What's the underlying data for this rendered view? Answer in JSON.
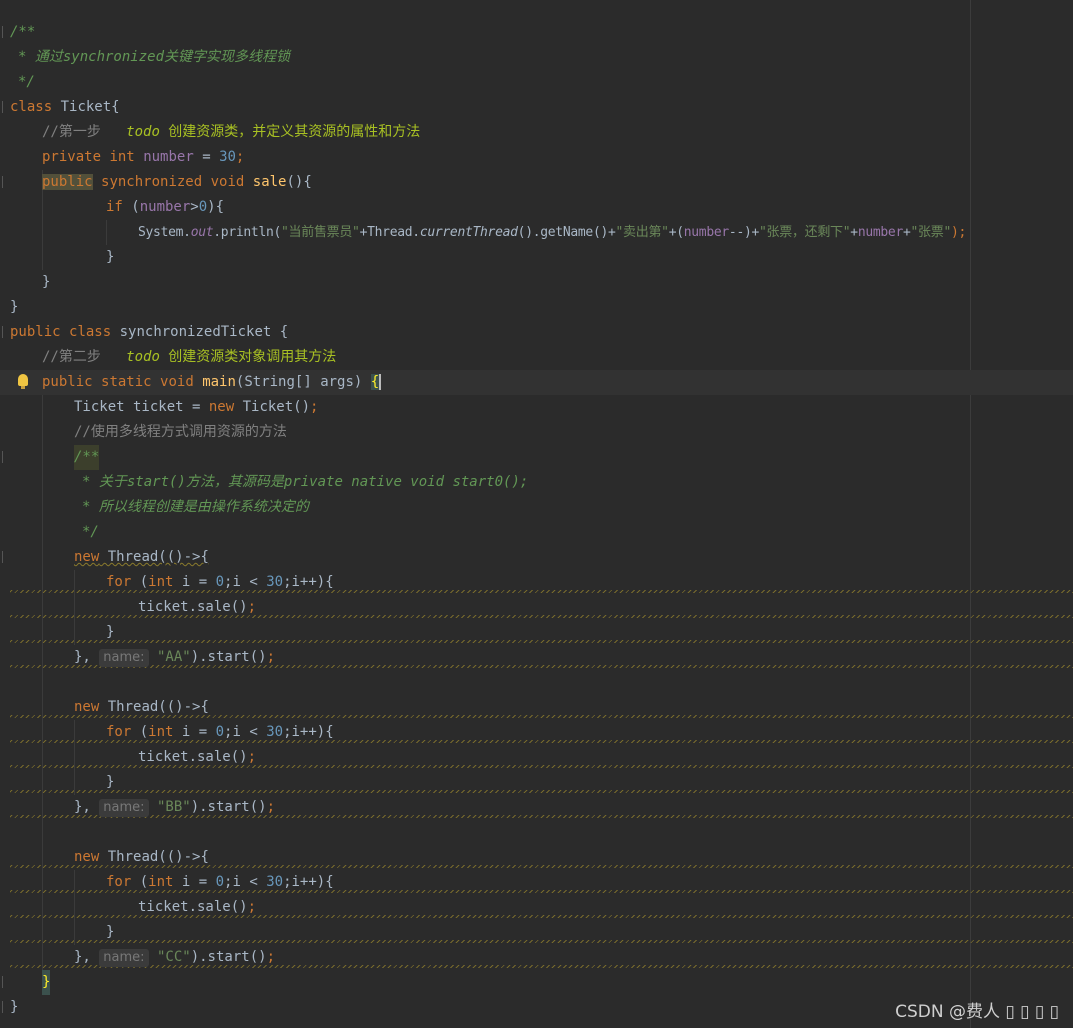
{
  "editor": {
    "l1": {
      "t": "/**"
    },
    "l2": {
      "star": "* ",
      "t1": "通过",
      "t2": "synchronized",
      "t3": "关键字实现多线程锁"
    },
    "l3": {
      "t": "*/"
    },
    "l4": {
      "kw": "class",
      "t": " Ticket{"
    },
    "l5": {
      "cmt": "//第一步   ",
      "todo": "todo",
      "todotxt": " 创建资源类，并定义其资源的属性和方法"
    },
    "l6": {
      "kw1": "private",
      "kw2": "int",
      "fld": "number",
      "eq": " = ",
      "num": "30",
      "semi": ";"
    },
    "l7": {
      "kw1": "public",
      "kw2": "synchronized",
      "kw3": "void",
      "fn": "sale",
      "rest": "(){"
    },
    "l8": {
      "kw": "if",
      "p1": " (",
      "fld": "number",
      "op": ">",
      "num": "0",
      "p2": "){"
    },
    "l9": {
      "a": "System.",
      "b": "out",
      "c": ".println(",
      "s1": "\"当前售票员\"",
      "d": "+Thread.",
      "e": "currentThread",
      "f": "().getName()+",
      "s2": "\"卖出第\"",
      "g": "+(",
      "fld1": "number",
      "h": "--)+",
      "s3": "\"张票，还剩下\"",
      "i": "+",
      "fld2": "number",
      "j": "+",
      "s4": "\"张票\"",
      "k": ");"
    },
    "l10": {
      "t": "}"
    },
    "l11": {
      "t": "}"
    },
    "l12": {
      "t": "}"
    },
    "l13": {
      "kw1": "public",
      "kw2": "class",
      "t": " synchronizedTicket {"
    },
    "l14": {
      "cmt": "//第二步   ",
      "todo": "todo",
      "todotxt": " 创建资源类对象调用其方法"
    },
    "l15": {
      "kw1": "public",
      "kw2": "static",
      "kw3": "void",
      "fn": "main",
      "rest": "(String[] args) ",
      "brace": "{"
    },
    "l16": {
      "a": "Ticket ticket = ",
      "kw": "new",
      "b": " Ticket()",
      "semi": ";"
    },
    "l17": {
      "t": "//使用多线程方式调用资源的方法"
    },
    "l18": {
      "t": "/**"
    },
    "l19": {
      "star": "* ",
      "t1": "关于",
      "t2": "start()",
      "t3": "方法，其源码是",
      "t4": "private native void start0();"
    },
    "l20": {
      "t": "* 所以线程创建是由操作系统决定的"
    },
    "l21": {
      "t": "*/"
    },
    "threads": [
      {
        "kw": "new",
        "head": " Thread(()->{",
        "for_kw": "for",
        "p": " (",
        "int_kw": "int",
        "a": " i = ",
        "n0": "0",
        "b": ";i < ",
        "n30": "30",
        "c": ";i++){",
        "call": "ticket.sale()",
        "semi": ";",
        "close": "}",
        "end1": "}, ",
        "hint": "name:",
        "str": "\"AA\"",
        "end2": ").start()",
        "end3": ";"
      },
      {
        "kw": "new",
        "head": " Thread(()->{",
        "for_kw": "for",
        "p": " (",
        "int_kw": "int",
        "a": " i = ",
        "n0": "0",
        "b": ";i < ",
        "n30": "30",
        "c": ";i++){",
        "call": "ticket.sale()",
        "semi": ";",
        "close": "}",
        "end1": "}, ",
        "hint": "name:",
        "str": "\"BB\"",
        "end2": ").start()",
        "end3": ";"
      },
      {
        "kw": "new",
        "head": " Thread(()->{",
        "for_kw": "for",
        "p": " (",
        "int_kw": "int",
        "a": " i = ",
        "n0": "0",
        "b": ";i < ",
        "n30": "30",
        "c": ";i++){",
        "call": "ticket.sale()",
        "semi": ";",
        "close": "}",
        "end1": "}, ",
        "hint": "name:",
        "str": "\"CC\"",
        "end2": ").start()",
        "end3": ";"
      }
    ],
    "l_main_close": {
      "t": "}"
    },
    "l_class_close": {
      "t": "}"
    }
  },
  "watermark": "CSDN @费人 ▯ ▯ ▯ ▯",
  "colors": {
    "background": "#2b2b2b",
    "keyword": "#cc7832",
    "string": "#6a8759",
    "number": "#6897bb",
    "field": "#9876aa",
    "doc": "#629755",
    "todo": "#a8c023",
    "method": "#ffc66d"
  }
}
